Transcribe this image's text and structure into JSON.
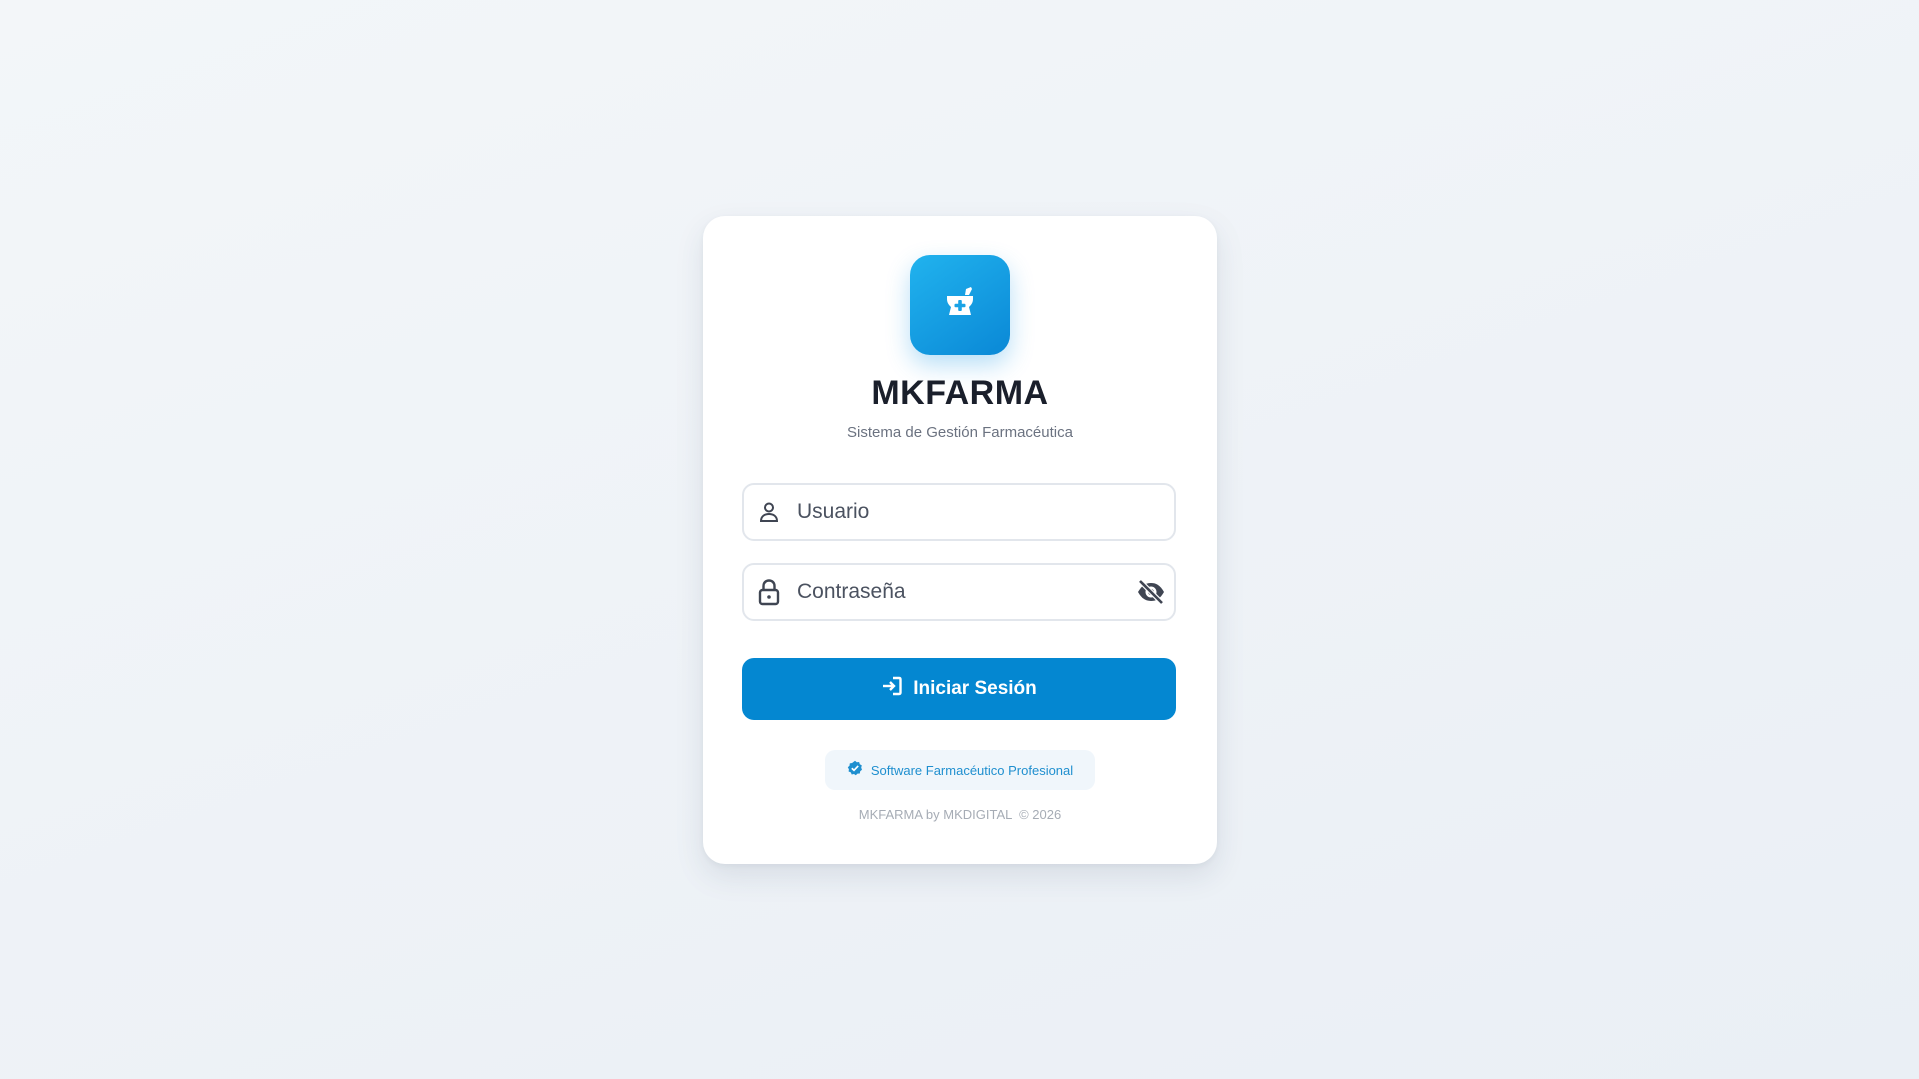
{
  "brand": {
    "title": "MKFARMA",
    "subtitle": "Sistema de Gestión Farmacéutica",
    "logo_icon": "mortar-pestle-icon",
    "accent_color": "#0487d1"
  },
  "form": {
    "username": {
      "placeholder": "Usuario",
      "value": "",
      "icon": "user-icon"
    },
    "password": {
      "placeholder": "Contraseña",
      "value": "",
      "icon": "lock-icon",
      "toggle_icon": "eye-slash-icon"
    },
    "submit_label": "Iniciar Sesión",
    "submit_icon": "sign-in-icon"
  },
  "badge": {
    "label": "Software Farmacéutico Profesional",
    "icon": "verified-badge-icon"
  },
  "footer": {
    "text": "MKFARMA by MKDIGITAL  © 2026"
  }
}
